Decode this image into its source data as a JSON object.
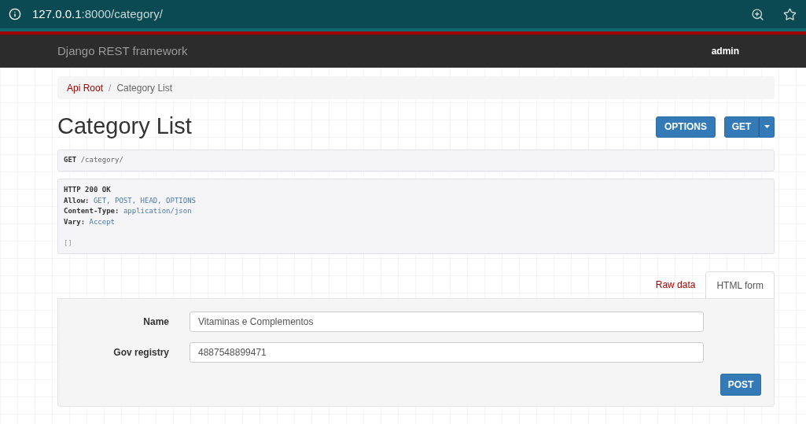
{
  "browser": {
    "url": {
      "host": "127.0.0.1",
      "path": ":8000/category/"
    }
  },
  "navbar": {
    "brand": "Django REST framework",
    "user": "admin"
  },
  "breadcrumb_separator": "/",
  "breadcrumbs": [
    {
      "label": "Api Root",
      "kind": "link"
    },
    {
      "label": "Category List",
      "kind": "current"
    }
  ],
  "title": "Category List",
  "actions": {
    "options": "OPTIONS",
    "get": "GET"
  },
  "request": {
    "method": "GET",
    "path": "/category/"
  },
  "response": {
    "status": "HTTP 200 OK",
    "headers": [
      {
        "key": "Allow:",
        "value": "GET, POST, HEAD, OPTIONS"
      },
      {
        "key": "Content-Type:",
        "value": "application/json"
      },
      {
        "key": "Vary:",
        "value": "Accept"
      }
    ],
    "body": "[]"
  },
  "tabs": [
    {
      "label": "Raw data",
      "selected": false
    },
    {
      "label": "HTML form",
      "selected": true
    }
  ],
  "form": {
    "fields": [
      {
        "label": "Name",
        "value": "Vitaminas e Complementos"
      },
      {
        "label": "Gov registry",
        "value": "4887548899471"
      }
    ],
    "submit": "POST"
  }
}
